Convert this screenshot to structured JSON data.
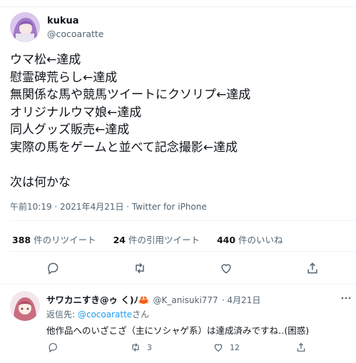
{
  "tweet": {
    "author_name": "kukua",
    "author_handle": "@cocoaratte",
    "lines": [
      "ウマ松←達成",
      "慰霊碑荒らし←達成",
      "無関係な馬や競馬ツイートにクソリプ←達成",
      "オリジナルウマ娘←達成",
      "同人グッズ販売←達成",
      "実際の馬をゲームと並べて記念撮影←達成",
      "",
      "次は何かな"
    ],
    "timestamp": "午前10:19 · 2021年4月21日 · Twitter for iPhone"
  },
  "stats": {
    "retweets_count": "388",
    "retweets_label": "件のリツイート",
    "quotes_count": "24",
    "quotes_label": "件の引用ツイート",
    "likes_count": "440",
    "likes_label": "件のいいね"
  },
  "actions": {
    "icons": [
      "reply-icon",
      "retweet-icon",
      "like-icon",
      "share-icon"
    ]
  },
  "reply": {
    "author_name": "サワカニすき@ゥ く)ﾉ🦀",
    "author_handle": "@K_anisuki777",
    "date": "· 4月21日",
    "replying_to_prefix": "返信先: ",
    "replying_to_handle": "@cocoaratte",
    "replying_to_suffix": "さん",
    "text": "他作品へのいざこざ（主にソシャゲ系）は達成済みですね‥(困惑)",
    "retweet_count": "3",
    "like_count": "12"
  },
  "colors": {
    "accent": "#1d9bf0",
    "secondary_text": "#536471",
    "divider": "#eff3f4"
  }
}
